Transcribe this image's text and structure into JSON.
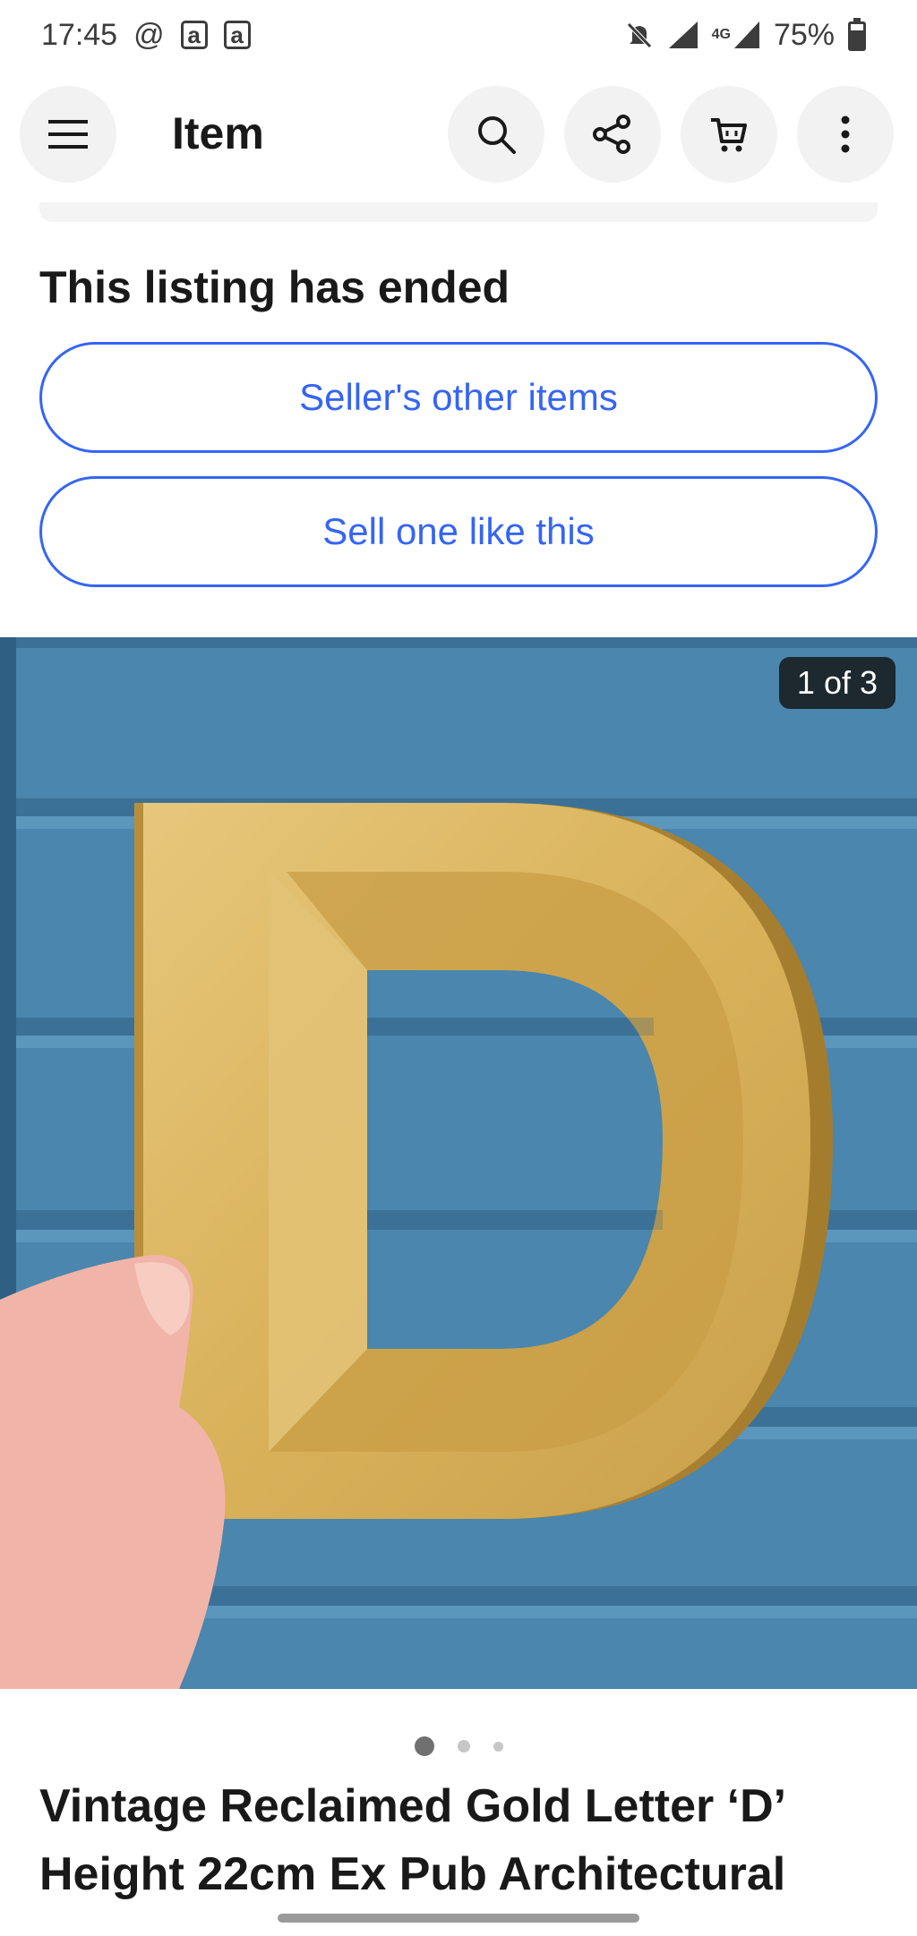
{
  "status_bar": {
    "time": "17:45",
    "at_symbol": "@",
    "app_icon_1": "a",
    "app_icon_2": "a",
    "network": "4G",
    "battery": "75%",
    "icons": [
      "mute-icon",
      "signal-icon",
      "network-4g-icon",
      "battery-icon"
    ]
  },
  "app_bar": {
    "title": "Item",
    "icons": [
      "menu-icon",
      "search-icon",
      "share-icon",
      "cart-icon",
      "more-icon"
    ]
  },
  "listing": {
    "ended_text": "This listing has ended",
    "seller_items_label": "Seller's other items",
    "sell_like_label": "Sell one like this"
  },
  "gallery": {
    "counter": "1 of 3",
    "current": 1,
    "total": 3,
    "image_subject": "gold letter D held against blue wooden siding"
  },
  "item": {
    "title": "Vintage Reclaimed Gold Letter ‘D’ Height 22cm Ex Pub Architectural"
  },
  "colors": {
    "accent": "#3665f3",
    "text": "#191919",
    "siding": "#4a86ad",
    "gold": "#d9b25a"
  }
}
